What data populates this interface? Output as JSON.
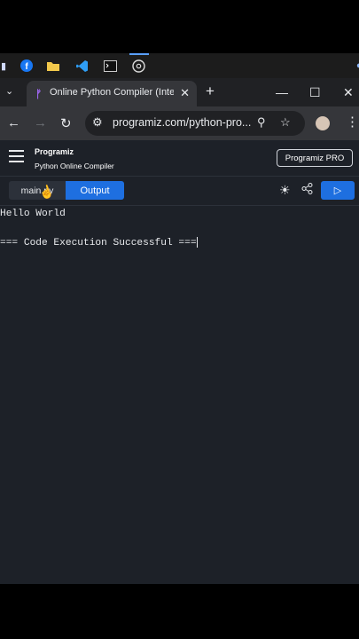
{
  "taskbar": {
    "icons": [
      "file-explorer-icon",
      "facebook-icon",
      "folder-icon",
      "vscode-icon",
      "terminal-icon",
      "chrome-icon"
    ]
  },
  "browser": {
    "tab_title": "Online Python Compiler (Interpr",
    "url": "programiz.com/python-pro...",
    "accent": "#1e6fe0"
  },
  "site": {
    "logo": "Programiz",
    "subtitle": "Python Online Compiler",
    "pro_button": "Programiz PRO"
  },
  "editor": {
    "file_tab": "main.py",
    "output_tab": "Output"
  },
  "console": {
    "lines": [
      "Hello World",
      "=== Code Execution Successful ==="
    ]
  }
}
